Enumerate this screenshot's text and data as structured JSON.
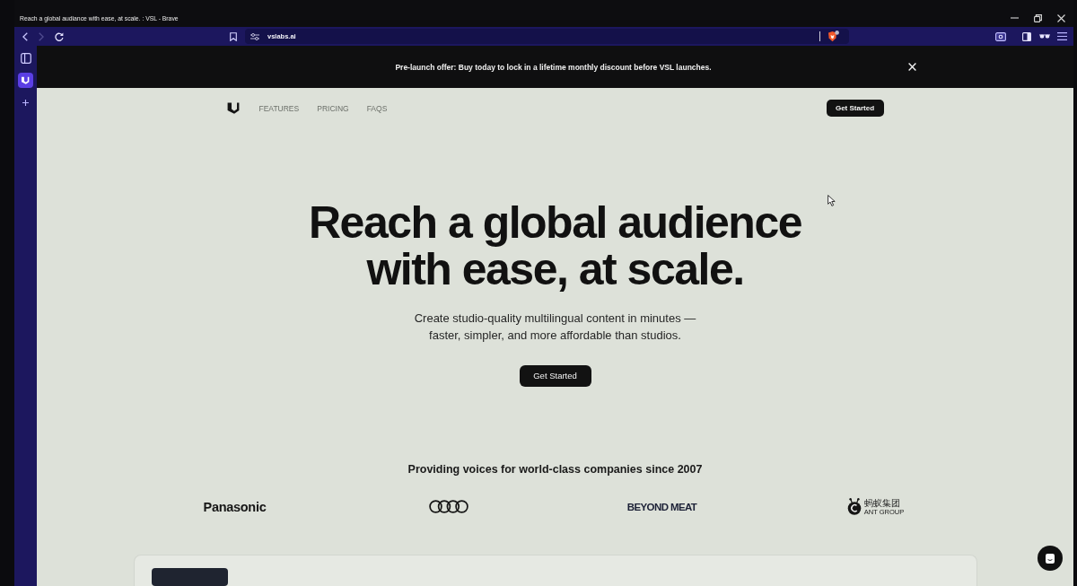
{
  "window": {
    "title": "Reach a global audiance with ease, at scale. : VSL - Brave"
  },
  "toolbar": {
    "nav_buttons": [
      {
        "kind": "back",
        "disabled": false
      },
      {
        "kind": "forward",
        "disabled": true
      },
      {
        "kind": "reload",
        "disabled": false
      }
    ],
    "url": "vslabs.ai"
  },
  "sidebar": {
    "items": [
      {
        "kind": "panel",
        "selected": false
      },
      {
        "kind": "site",
        "selected": true
      },
      {
        "kind": "add",
        "selected": false
      }
    ]
  },
  "banner": {
    "text": "Pre-launch offer: Buy today to lock in a lifetime monthly discount before VSL launches."
  },
  "nav": {
    "links": [
      "FEATURES",
      "PRICING",
      "FAQS"
    ],
    "button": "Get Started"
  },
  "hero": {
    "title_lines": [
      "Reach a global audience",
      "with ease, at scale."
    ],
    "subtitle_lines": [
      "Create studio-quality multilingual content in minutes —",
      "faster, simpler, and more affordable than studios."
    ],
    "button": "Get Started"
  },
  "clients": {
    "heading": "Providing voices for world-class companies since 2007",
    "logos": [
      {
        "kind": "wordmark",
        "text": "Panasonic"
      },
      {
        "kind": "rings"
      },
      {
        "kind": "heavy_wordmark",
        "text": "BEYOND MEAT"
      },
      {
        "kind": "ant",
        "text_top": "蚂蚁集团",
        "text_bottom": "ANT GROUP"
      }
    ]
  }
}
